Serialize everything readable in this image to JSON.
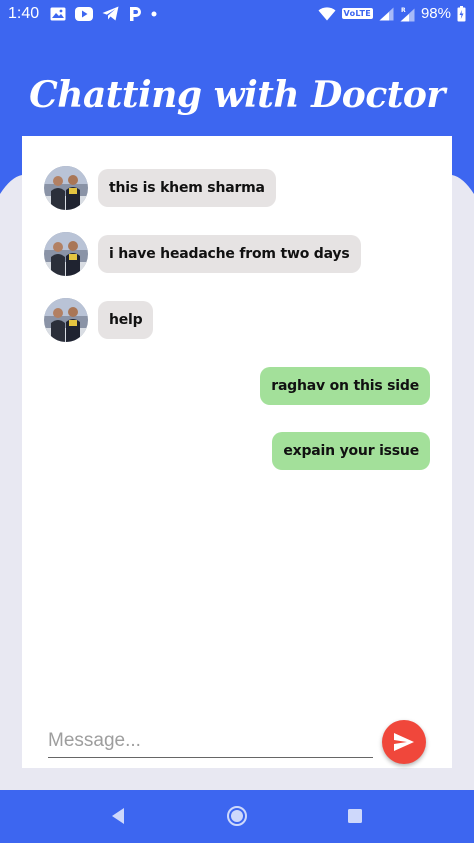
{
  "status_bar": {
    "time": "1:40",
    "network_badge": "VoLTE",
    "battery_percent": "98%",
    "left_icons": [
      "image-icon",
      "youtube-icon",
      "telegram-icon",
      "paytm-icon",
      "dot-icon"
    ],
    "right_icons": [
      "wifi-icon",
      "volte-icon",
      "signal-icon",
      "signal-roaming-icon",
      "battery-icon"
    ]
  },
  "header": {
    "title": "Chatting with Doctor"
  },
  "messages": [
    {
      "direction": "received",
      "text": "this is khem sharma"
    },
    {
      "direction": "received",
      "text": "i have headache from two days"
    },
    {
      "direction": "received",
      "text": "help"
    },
    {
      "direction": "sent",
      "text": "raghav on this side"
    },
    {
      "direction": "sent",
      "text": "expain your issue"
    }
  ],
  "composer": {
    "placeholder": "Message...",
    "value": "",
    "send_icon": "send-icon"
  },
  "nav_bar": {
    "buttons": [
      "back-icon",
      "home-icon",
      "recents-icon"
    ]
  },
  "colors": {
    "primary": "#3d66f0",
    "received_bubble": "#e6e3e3",
    "sent_bubble": "#a3e09a",
    "send_button": "#f0473b",
    "page_background": "#e8e8f2"
  }
}
